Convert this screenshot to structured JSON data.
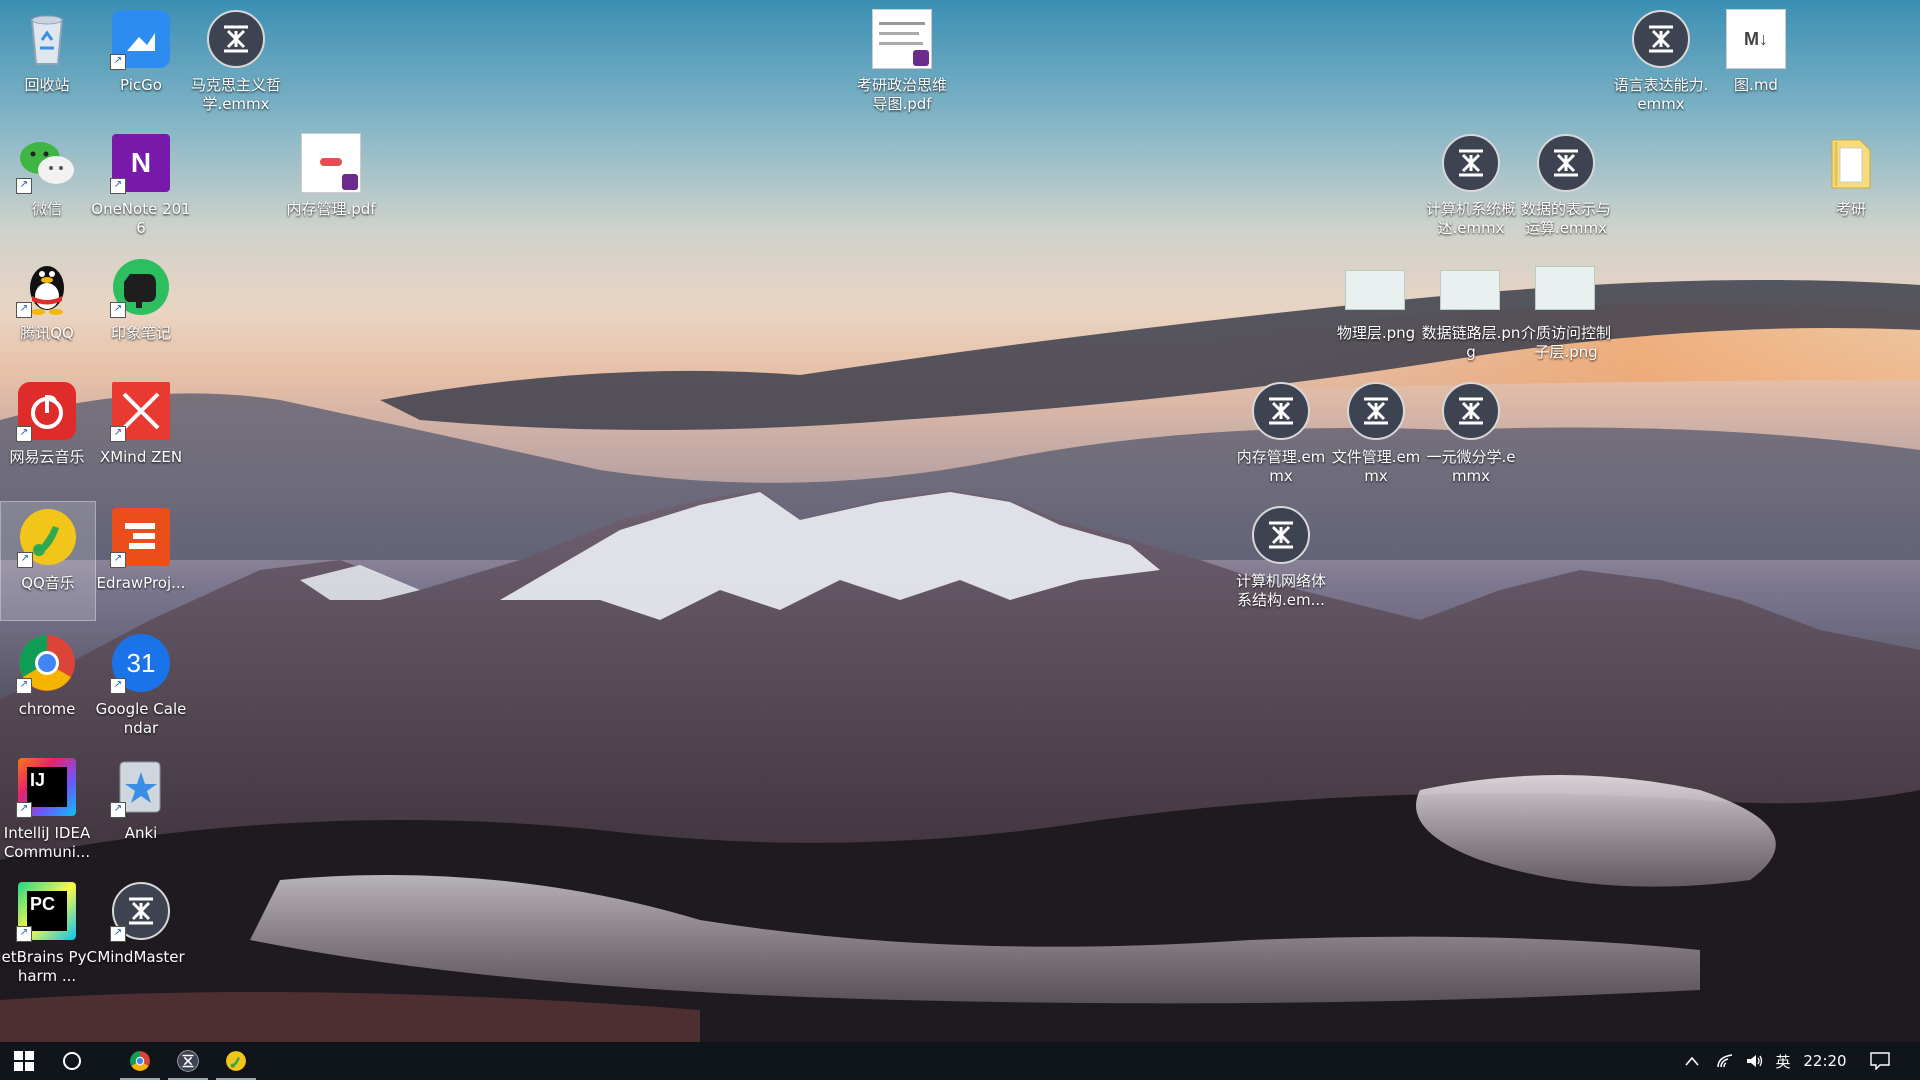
{
  "desktop": {
    "icons": {
      "recycle_bin": "回收站",
      "picgo": "PicGo",
      "marxism": "马克思主义哲学.emmx",
      "politics_pdf": "考研政治思维导图.pdf",
      "language_expr": "语言表达能力.emmx",
      "tu_md": "图.md",
      "wechat": "微信",
      "onenote": "OneNote 2016",
      "memory_pdf": "内存管理.pdf",
      "computer_overview": "计算机系统概述.emmx",
      "data_repr": "数据的表示与运算.emmx",
      "kaoyan_folder": "考研",
      "qq": "腾讯QQ",
      "evernote": "印象笔记",
      "physical_png": "物理层.png",
      "datalink_png": "数据链路层.png",
      "mac_png": "介质访问控制子层.png",
      "netease": "网易云音乐",
      "xmind": "XMind ZEN",
      "memory_emmx": "内存管理.emmx",
      "file_emmx": "文件管理.emmx",
      "calculus_emmx": "一元微分学.emmx",
      "qqmusic": "QQ音乐",
      "edraw": "EdrawProj...",
      "network_emmx": "计算机网络体系结构.em...",
      "chrome": "chrome",
      "gcal": "Google Calendar",
      "intellij": "IntelliJ IDEA Communi...",
      "anki": "Anki",
      "pycharm": "JetBrains PyCharm ...",
      "mindmaster": "MindMaster"
    },
    "glyphs": {
      "onenote": "N",
      "gcal": "31",
      "intellij": "IJ",
      "pycharm": "PC",
      "md": "M↓",
      "shortcut": "↗"
    }
  },
  "taskbar": {
    "ime": "英",
    "clock": "22:20",
    "tray_up": "^"
  },
  "colors": {
    "taskbar_bg": "#10151c",
    "mindmaster_bg": "#3d4350",
    "qq_music": "#f2c51a",
    "netease": "#e02b2b"
  }
}
